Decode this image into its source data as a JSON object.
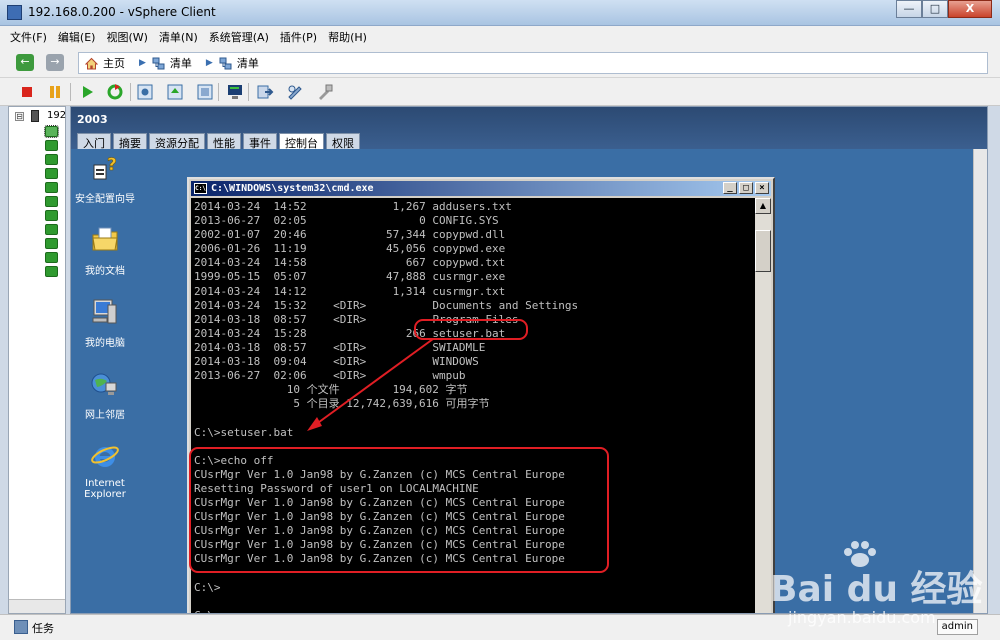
{
  "window": {
    "title": "192.168.0.200 - vSphere Client",
    "minimize": "—",
    "maximize": "□",
    "close": "X"
  },
  "menu": [
    "文件(F)",
    "编辑(E)",
    "视图(W)",
    "清单(N)",
    "系统管理(A)",
    "插件(P)",
    "帮助(H)"
  ],
  "nav": {
    "back": "←",
    "forward": "→",
    "breadcrumbs": [
      {
        "label": "主页",
        "icon": "home-icon"
      },
      {
        "label": "清单",
        "icon": "inventory-icon"
      },
      {
        "label": "清单",
        "icon": "inventory-icon"
      }
    ]
  },
  "tree": {
    "expander": "⊟",
    "host_label": "192"
  },
  "vm": {
    "name": "2003",
    "tabs": [
      "入门",
      "摘要",
      "资源分配",
      "性能",
      "事件",
      "控制台",
      "权限"
    ],
    "active_tab": "控制台"
  },
  "desktop_icons": [
    {
      "label": "安全配置向导",
      "icon": "security-wizard-icon"
    },
    {
      "label": "我的文档",
      "icon": "my-documents-icon"
    },
    {
      "label": "我的电脑",
      "icon": "my-computer-icon"
    },
    {
      "label": "网上邻居",
      "icon": "network-places-icon"
    },
    {
      "label": "Internet\nExplorer",
      "icon": "internet-explorer-icon"
    }
  ],
  "cmd": {
    "title": "C:\\WINDOWS\\system32\\cmd.exe",
    "icon_text": "C:\\",
    "buttons": [
      "_",
      "□",
      "×"
    ],
    "lines": [
      "2014-03-24  14:52             1,267 addusers.txt",
      "2013-06-27  02:05                 0 CONFIG.SYS",
      "2002-01-07  20:46            57,344 copypwd.dll",
      "2006-01-26  11:19            45,056 copypwd.exe",
      "2014-03-24  14:58               667 copypwd.txt",
      "1999-05-15  05:07            47,888 cusrmgr.exe",
      "2014-03-24  14:12             1,314 cusrmgr.txt",
      "2014-03-24  15:32    <DIR>          Documents and Settings",
      "2014-03-18  08:57    <DIR>          Program Files",
      "2014-03-24  15:28               266 setuser.bat",
      "2014-03-18  08:57    <DIR>          SWIADMLE",
      "2014-03-18  09:04    <DIR>          WINDOWS",
      "2013-06-27  02:06    <DIR>          wmpub",
      "              10 个文件        194,602 字节",
      "               5 个目录 12,742,639,616 可用字节",
      "",
      "C:\\>setuser.bat",
      "",
      "C:\\>echo off",
      "CUsrMgr Ver 1.0 Jan98 by G.Zanzen (c) MCS Central Europe",
      "Resetting Password of user1 on LOCALMACHINE",
      "CUsrMgr Ver 1.0 Jan98 by G.Zanzen (c) MCS Central Europe",
      "CUsrMgr Ver 1.0 Jan98 by G.Zanzen (c) MCS Central Europe",
      "CUsrMgr Ver 1.0 Jan98 by G.Zanzen (c) MCS Central Europe",
      "CUsrMgr Ver 1.0 Jan98 by G.Zanzen (c) MCS Central Europe",
      "CUsrMgr Ver 1.0 Jan98 by G.Zanzen (c) MCS Central Europe",
      "",
      "C:\\>",
      "",
      "C:\\>"
    ]
  },
  "status": {
    "task_label": "任务",
    "user": "admin"
  },
  "watermark": {
    "text": "Bai du 经验",
    "url": "jingyan.baidu.com"
  },
  "colors": {
    "desktop": "#3a6ea5",
    "annotation": "#e01e24",
    "cmd_title_start": "#0a246a"
  }
}
